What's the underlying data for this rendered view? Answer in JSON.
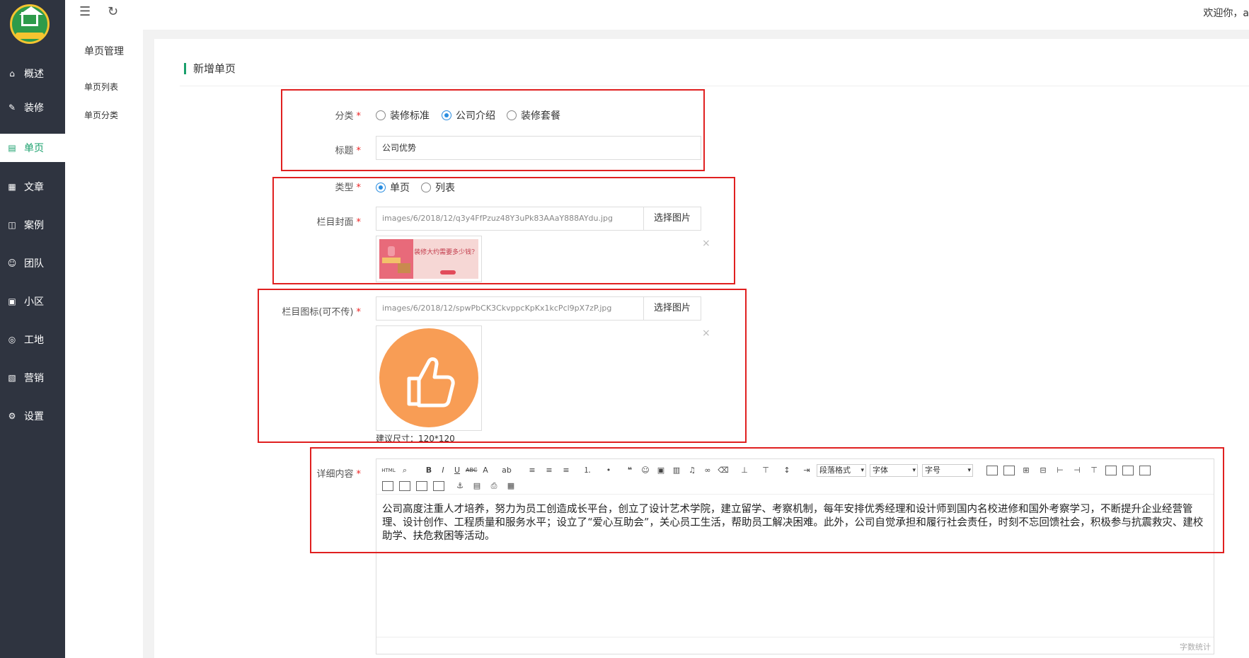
{
  "nav": {
    "items": [
      {
        "label": "概述",
        "icon": "home-icon",
        "glyph": "⌂",
        "active": false
      },
      {
        "label": "装修",
        "icon": "brush-icon",
        "glyph": "✎",
        "active": false
      },
      {
        "label": "单页",
        "icon": "page-icon",
        "glyph": "▤",
        "active": true
      },
      {
        "label": "文章",
        "icon": "grid-icon",
        "glyph": "▦",
        "active": false
      },
      {
        "label": "案例",
        "icon": "layout-icon",
        "glyph": "◫",
        "active": false
      },
      {
        "label": "团队",
        "icon": "user-icon",
        "glyph": "☺",
        "active": false
      },
      {
        "label": "小区",
        "icon": "building-icon",
        "glyph": "▣",
        "active": false
      },
      {
        "label": "工地",
        "icon": "location-icon",
        "glyph": "◎",
        "active": false
      },
      {
        "label": "营销",
        "icon": "marketing-icon",
        "glyph": "▧",
        "active": false
      },
      {
        "label": "设置",
        "icon": "gear-icon",
        "glyph": "⚙",
        "active": false
      }
    ]
  },
  "subnav": {
    "title": "单页管理",
    "items": [
      "单页列表",
      "单页分类"
    ]
  },
  "topbar": {
    "menu_glyph": "☰",
    "refresh_glyph": "↻",
    "welcome": "欢迎你，a"
  },
  "page": {
    "title": "新增单页"
  },
  "form": {
    "category": {
      "label": "分类",
      "options": [
        "装修标准",
        "公司介绍",
        "装修套餐"
      ],
      "selected": 1
    },
    "title_field": {
      "label": "标题",
      "value": "公司优势"
    },
    "type": {
      "label": "类型",
      "options": [
        "单页",
        "列表"
      ],
      "selected": 0
    },
    "cover": {
      "label": "栏目封面",
      "path": "images/6/2018/12/q3y4FfPzuz48Y3uPk83AAaY888AYdu.jpg",
      "button": "选择图片",
      "banner_text": "装修大约需要多少钱?"
    },
    "icon_field": {
      "label": "栏目图标(可不传)",
      "path": "images/6/2018/12/spwPbCK3CkvppcKpKx1kcPcl9pX7zP.jpg",
      "button": "选择图片",
      "hint": "建议尺寸：120*120"
    },
    "detail": {
      "label": "详细内容",
      "toolbar": {
        "html": "HTML",
        "paragraph": "段落格式",
        "font": "字体",
        "size": "字号"
      },
      "content": "公司高度注重人才培养，努力为员工创造成长平台，创立了设计艺术学院，建立留学、考察机制，每年安排优秀经理和设计师到国内名校进修和国外考察学习，不断提升企业经营管理、设计创作、工程质量和服务水平；设立了“爱心互助会”，关心员工生活，帮助员工解决困难。此外，公司自觉承担和履行社会责任，时刻不忘回馈社会，积极参与抗震救灾、建校助学、扶危救困等活动。",
      "counter": "字数统计"
    },
    "required_mark": "*",
    "remove_glyph": "×"
  },
  "colors": {
    "accent": "#1aa06c",
    "sidebar": "#2f3440",
    "annotation": "#e02020",
    "radio": "#2a8de0"
  }
}
